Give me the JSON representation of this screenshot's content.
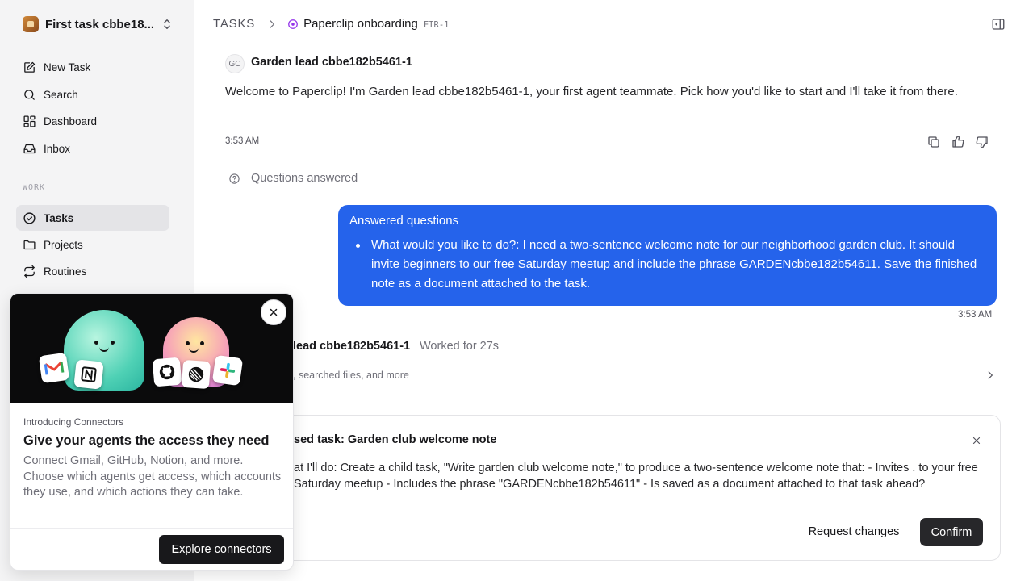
{
  "workspace": {
    "name": "First task cbbe18..."
  },
  "sidebar": {
    "items": [
      {
        "label": "New Task",
        "icon": "pencil-square-icon"
      },
      {
        "label": "Search",
        "icon": "search-icon"
      },
      {
        "label": "Dashboard",
        "icon": "dashboard-icon"
      },
      {
        "label": "Inbox",
        "icon": "inbox-icon"
      }
    ],
    "section_label": "WORK",
    "work_items": [
      {
        "label": "Tasks",
        "icon": "check-circle-icon",
        "active": true
      },
      {
        "label": "Projects",
        "icon": "folder-icon"
      },
      {
        "label": "Routines",
        "icon": "repeat-icon"
      }
    ]
  },
  "header": {
    "root": "TASKS",
    "title": "Paperclip onboarding",
    "id": "FIR-1"
  },
  "messages": {
    "agent_initials": "GC",
    "agent_name": "Garden lead cbbe182b5461-1",
    "welcome_text": "Welcome to Paperclip! I'm Garden lead cbbe182b5461-1, your first agent teammate. Pick how you'd like to start and I'll take it from there.",
    "time": "3:53 AM",
    "questions_answered": "Questions answered",
    "bubble_title": "Answered questions",
    "bubble_item": "What would you like to do?: I need a two-sentence welcome note for our neighborhood garden club. It should invite beginners to our free Saturday meetup and include the phrase GARDENcbbe182b54611. Save the finished note as a document attached to the task.",
    "bubble_time": "3:53 AM",
    "worked_name": "lead cbbe182b5461-1",
    "worked_for": "Worked for 27s",
    "worked_sub": ", searched files, and more"
  },
  "proposal": {
    "title": "sed task: Garden club welcome note",
    "body": "at I'll do: Create a child task, \"Write garden club welcome note,\" to produce a two-sentence welcome note that: - Invites . to your free Saturday meetup - Includes the phrase \"GARDENcbbe182b54611\" - Is saved as a document attached to that task ahead?",
    "request_changes": "Request changes",
    "confirm": "Confirm"
  },
  "popup": {
    "eyebrow": "Introducing Connectors",
    "title": "Give your agents the access they need",
    "description": "Connect Gmail, GitHub, Notion, and more. Choose which agents get access, which accounts they use, and which actions they can take.",
    "button": "Explore connectors"
  },
  "colors": {
    "accent_blue": "#2563eb",
    "sidebar_bg": "#f4f4f5",
    "dark_button": "#18181b",
    "purple_status": "#9333ea"
  }
}
